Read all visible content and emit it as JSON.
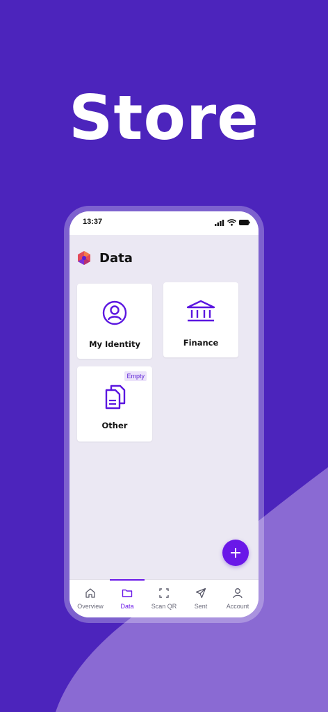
{
  "hero": {
    "title": "Store"
  },
  "status_bar": {
    "time": "13:37"
  },
  "header": {
    "title": "Data"
  },
  "cards": [
    {
      "label": "My Identity",
      "icon": "user-circle-icon",
      "badge": ""
    },
    {
      "label": "Finance",
      "icon": "bank-icon",
      "badge": ""
    },
    {
      "label": "Other",
      "icon": "documents-icon",
      "badge": "Empty"
    }
  ],
  "tabs": [
    {
      "label": "Overview",
      "icon": "home-icon",
      "active": false
    },
    {
      "label": "Data",
      "icon": "folder-icon",
      "active": true
    },
    {
      "label": "Scan QR",
      "icon": "scan-icon",
      "active": false
    },
    {
      "label": "Sent",
      "icon": "send-icon",
      "active": false
    },
    {
      "label": "Account",
      "icon": "user-icon",
      "active": false
    }
  ],
  "colors": {
    "background": "#4c24bc",
    "accent": "#6a18e8",
    "screen": "#ebe8f3"
  }
}
